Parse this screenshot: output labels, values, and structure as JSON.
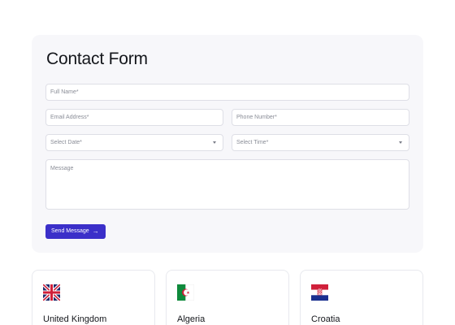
{
  "form": {
    "title": "Contact Form",
    "full_name_placeholder": "Full Name*",
    "email_placeholder": "Email Address*",
    "phone_placeholder": "Phone Number*",
    "date_placeholder": "Select Date*",
    "time_placeholder": "Select Time*",
    "message_placeholder": "Message",
    "submit_label": "Send Message",
    "submit_icon": "arrow-right-icon",
    "accent_color": "#3b2fc9"
  },
  "countries": [
    {
      "name": "United Kingdom",
      "flag_icon": "uk-flag-icon"
    },
    {
      "name": "Algeria",
      "flag_icon": "algeria-flag-icon"
    },
    {
      "name": "Croatia",
      "flag_icon": "croatia-flag-icon"
    }
  ]
}
